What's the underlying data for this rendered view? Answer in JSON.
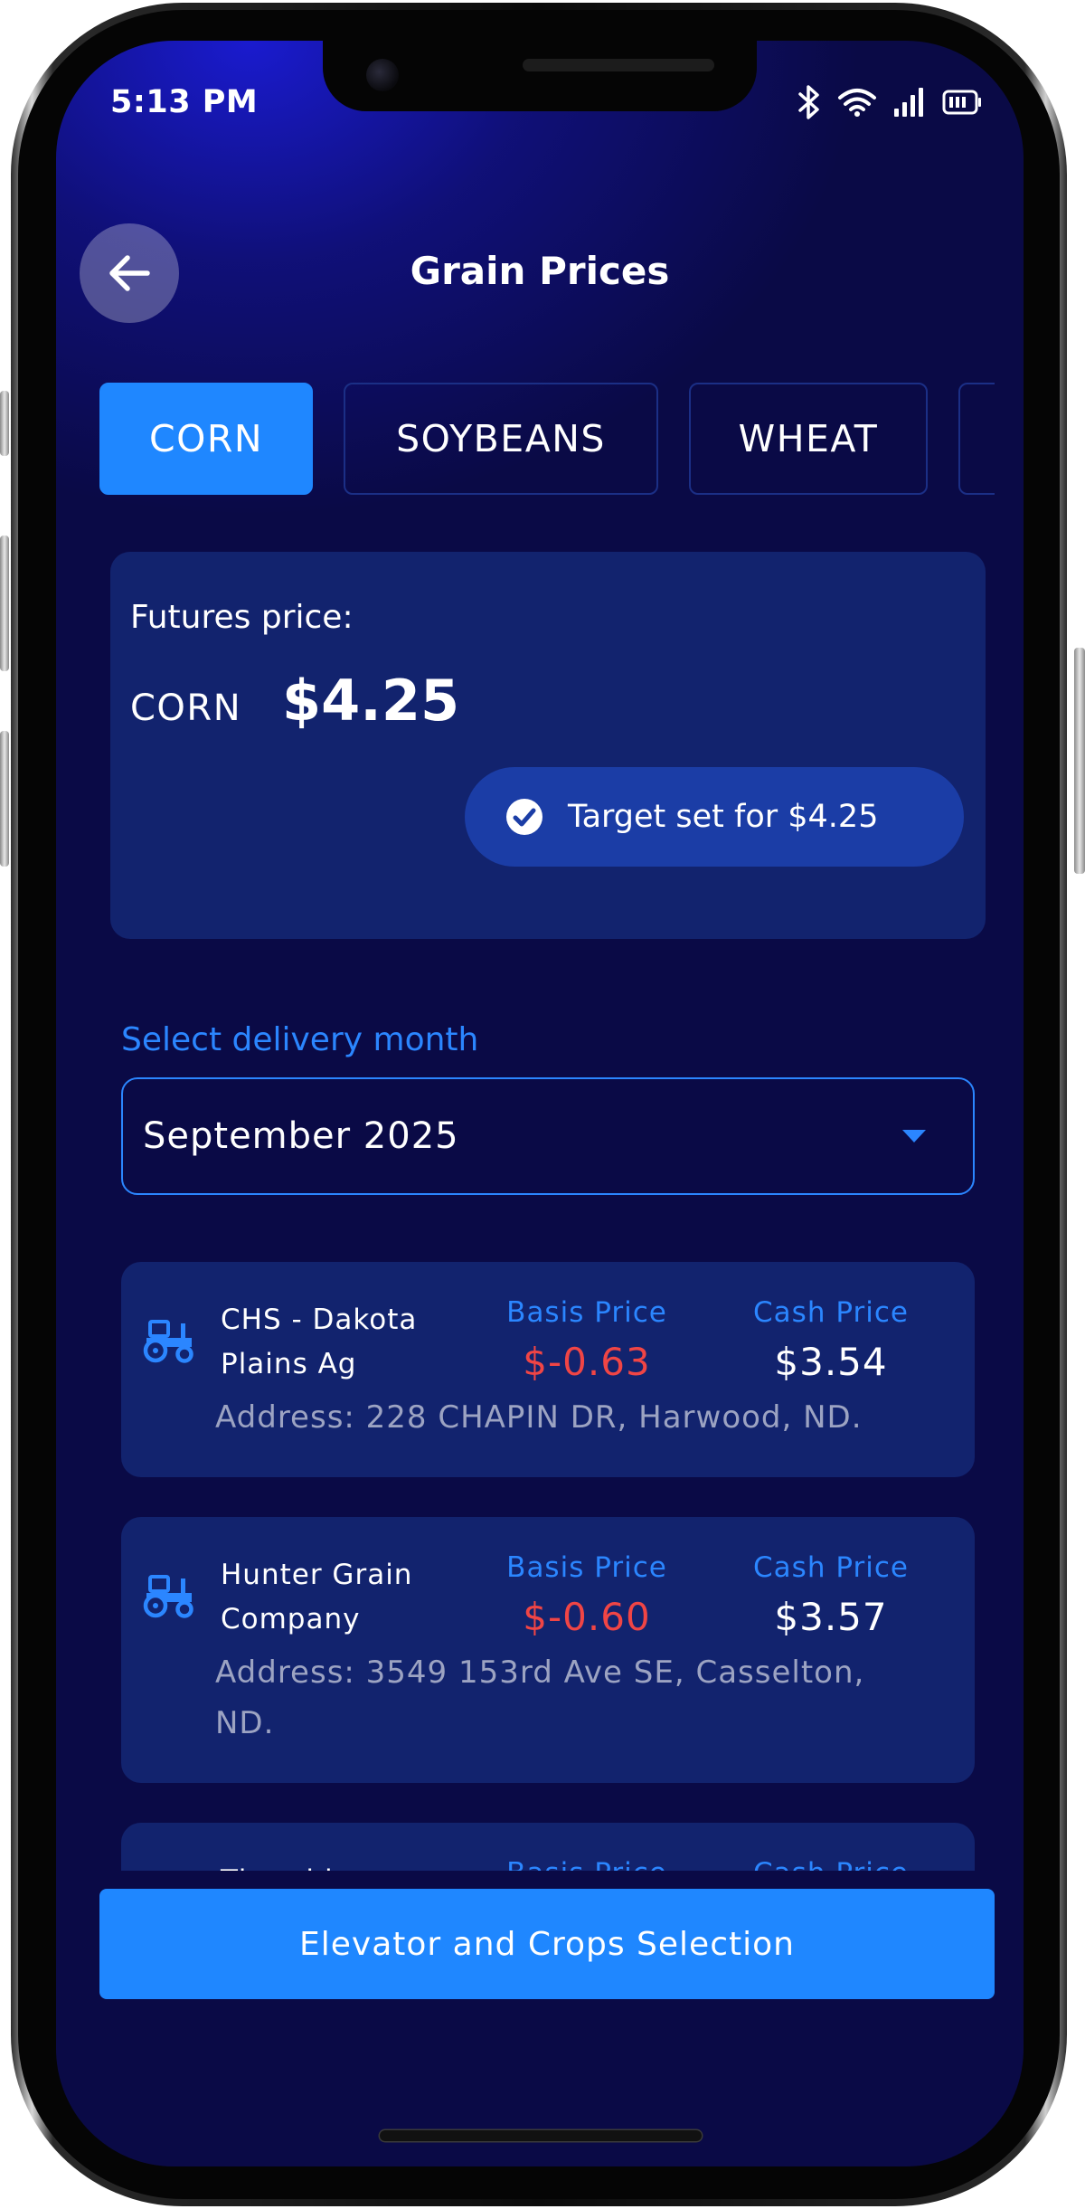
{
  "status_bar": {
    "time": "5:13 PM",
    "icons": [
      "bluetooth-icon",
      "wifi-icon",
      "signal-icon",
      "battery-icon"
    ]
  },
  "header": {
    "title": "Grain Prices",
    "back_icon": "arrow-left-icon"
  },
  "tabs": [
    {
      "label": "CORN",
      "active": true
    },
    {
      "label": "SOYBEANS",
      "active": false
    },
    {
      "label": "WHEAT",
      "active": false
    },
    {
      "label": "",
      "active": false
    }
  ],
  "futures": {
    "label": "Futures price:",
    "crop": "CORN",
    "price": "$4.25",
    "target_text": "Target set for $4.25",
    "target_icon": "check-circle-icon"
  },
  "delivery": {
    "label": "Select delivery month",
    "selected": "September 2025",
    "icon": "caret-down-icon"
  },
  "elevators": [
    {
      "name_lines": [
        "CHS - Dakota",
        "Plains Ag"
      ],
      "basis_label": "Basis Price",
      "basis": "$-0.63",
      "cash_label": "Cash Price",
      "cash": "$3.54",
      "address_lines": [
        "Address: 228 CHAPIN DR, Harwood, ND."
      ]
    },
    {
      "name_lines": [
        "Hunter Grain",
        "Company"
      ],
      "basis_label": "Basis Price",
      "basis": "$-0.60",
      "cash_label": "Cash Price",
      "cash": "$3.57",
      "address_lines": [
        "Address: 3549 153rd Ave SE, Casselton,",
        "ND."
      ]
    },
    {
      "name_lines": [
        "Tharaldson",
        ""
      ],
      "basis_label": "Basis Price",
      "basis": "",
      "cash_label": "Cash Price",
      "cash": "",
      "address_lines": []
    }
  ],
  "bottom_button": {
    "label": "Elevator and Crops Selection"
  },
  "colors": {
    "accent": "#1f87ff",
    "card": "#12236e",
    "background": "#0a0a46",
    "negative": "#f04545"
  }
}
